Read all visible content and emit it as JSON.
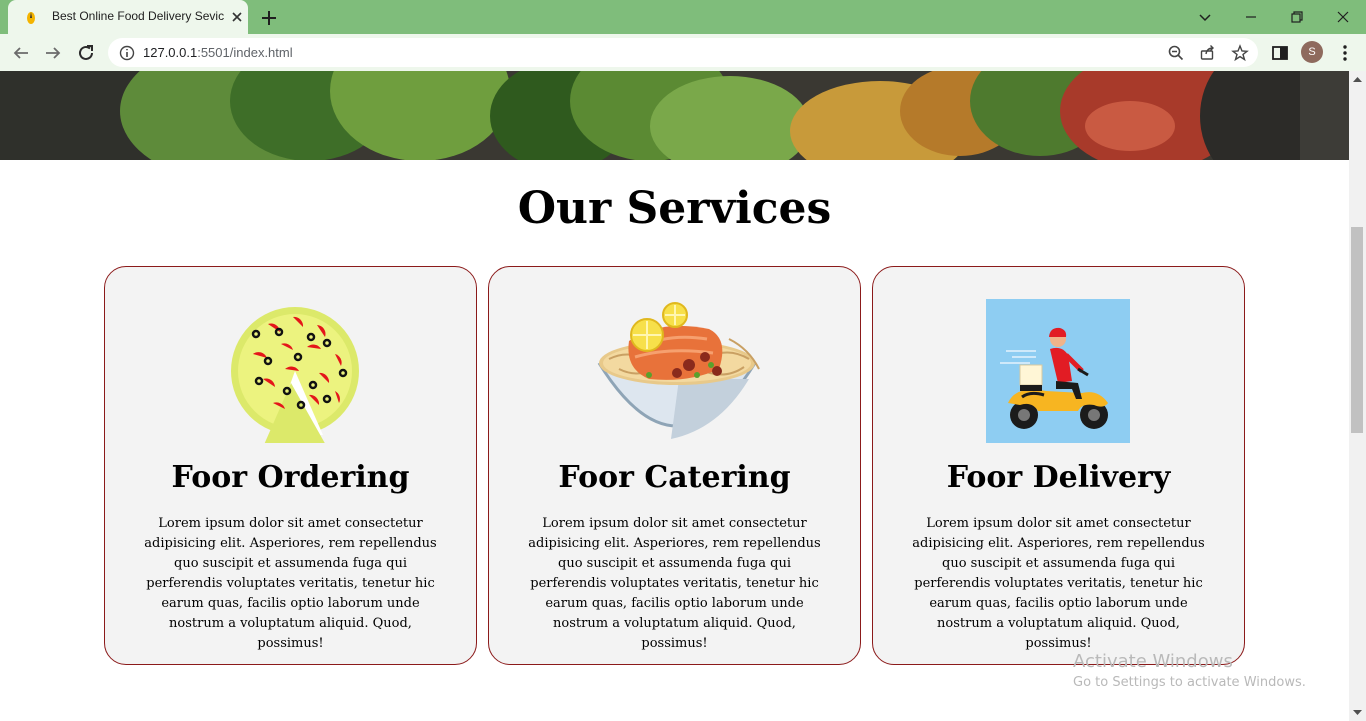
{
  "browser": {
    "tab_title": "Best Online Food Delivery Sevice",
    "url_host": "127.0.0.1",
    "url_path": ":5501/index.html",
    "profile_initial": "S"
  },
  "page": {
    "section_title": "Our Services",
    "services": [
      {
        "title": "Foor Ordering",
        "text": "Lorem ipsum dolor sit amet consectetur adipisicing elit. Asperiores, rem repellendus quo suscipit et assumenda fuga qui perferendis voluptates veritatis, tenetur hic earum quas, facilis optio laborum unde nostrum a voluptatum aliquid. Quod, possimus!",
        "icon": "pizza-icon"
      },
      {
        "title": "Foor Catering",
        "text": "Lorem ipsum dolor sit amet consectetur adipisicing elit. Asperiores, rem repellendus quo suscipit et assumenda fuga qui perferendis voluptates veritatis, tenetur hic earum quas, facilis optio laborum unde nostrum a voluptatum aliquid. Quod, possimus!",
        "icon": "salmon-bowl-icon"
      },
      {
        "title": "Foor Delivery",
        "text": "Lorem ipsum dolor sit amet consectetur adipisicing elit. Asperiores, rem repellendus quo suscipit et assumenda fuga qui perferendis voluptates veritatis, tenetur hic earum quas, facilis optio laborum unde nostrum a voluptatum aliquid. Quod, possimus!",
        "icon": "delivery-scooter-icon"
      }
    ]
  },
  "watermark": {
    "line1": "Activate Windows",
    "line2": "Go to Settings to activate Windows."
  },
  "colors": {
    "tabbar": "#7fbd7b",
    "toolbar": "#eef7ec",
    "card_border": "#8b1a1a",
    "card_bg": "#f3f3f3"
  }
}
